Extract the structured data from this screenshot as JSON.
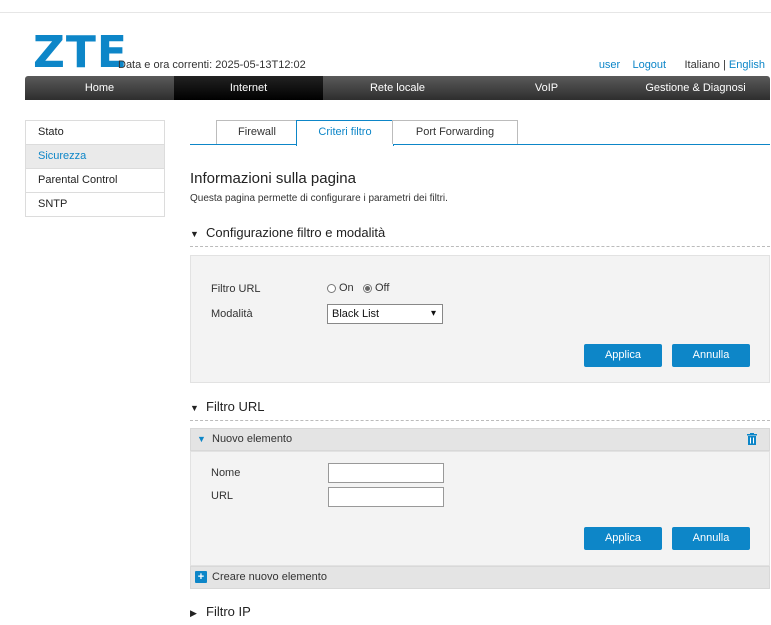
{
  "header": {
    "logo": "ZTE",
    "datetime": "Data e ora correnti: 2025-05-13T12:02",
    "user": "user",
    "logout": "Logout",
    "lang_it": "Italiano",
    "separator": "|",
    "lang_en": "English"
  },
  "nav": [
    "Home",
    "Internet",
    "Rete locale",
    "VoIP",
    "Gestione & Diagnosi"
  ],
  "sidebar": [
    "Stato",
    "Sicurezza",
    "Parental Control",
    "SNTP"
  ],
  "tabs": [
    "Firewall",
    "Criteri filtro",
    "Port Forwarding"
  ],
  "page": {
    "title": "Informazioni sulla pagina",
    "description": "Questa pagina permette di configurare i parametri dei filtri."
  },
  "config_section": {
    "title": "Configurazione filtro e modalità",
    "url_filter_label": "Filtro URL",
    "on_label": "On",
    "off_label": "Off",
    "selected": "Off",
    "mode_label": "Modalità",
    "mode_value": "Black List",
    "apply": "Applica",
    "cancel": "Annulla"
  },
  "url_section": {
    "title": "Filtro URL",
    "new_item": "Nuovo elemento",
    "name_label": "Nome",
    "url_label": "URL",
    "name_value": "",
    "url_value": "",
    "apply": "Applica",
    "cancel": "Annulla",
    "create": "Creare nuovo elemento"
  },
  "ip_section": {
    "title": "Filtro IP"
  },
  "colors": {
    "accent": "#0d86c8",
    "nav_dark": "#2e2e2e"
  }
}
